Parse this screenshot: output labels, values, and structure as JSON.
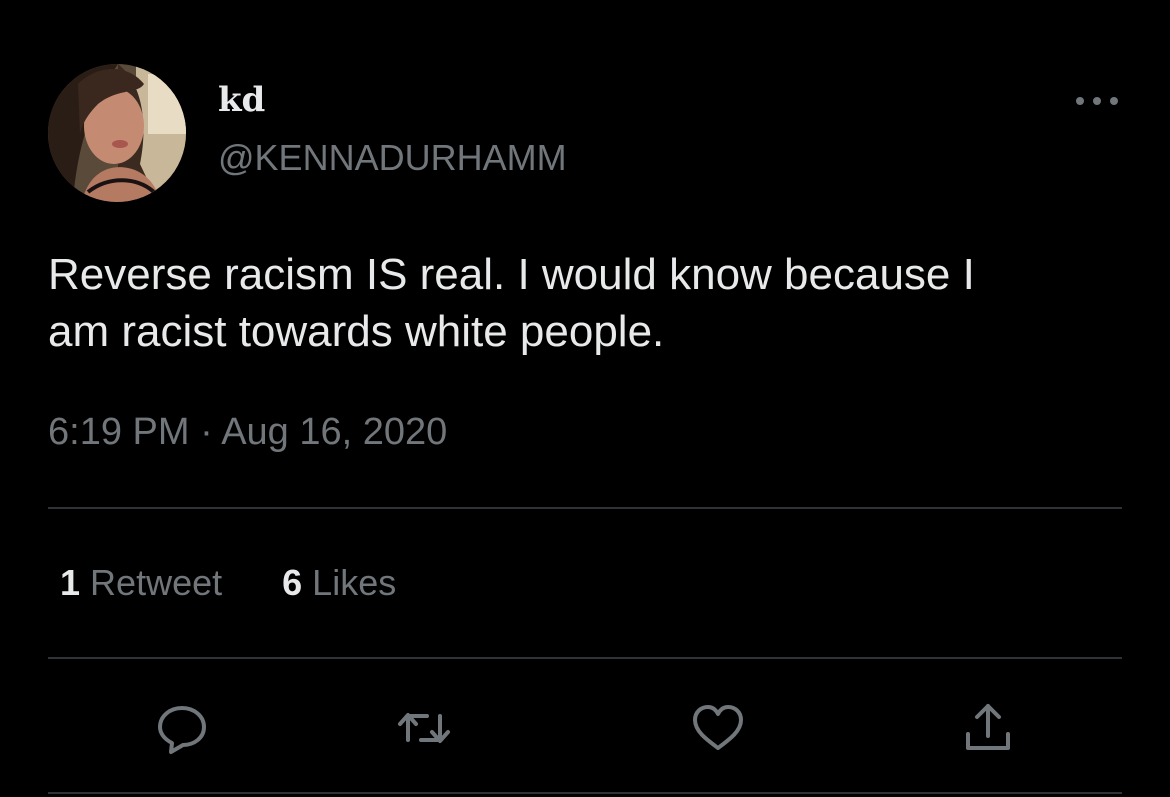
{
  "user": {
    "display_name": "kd",
    "handle": "@KENNADURHAMM"
  },
  "tweet": {
    "text_line1": "Reverse racism IS real. I would know because I",
    "text_line2": "am racist towards white people.",
    "timestamp": "6:19 PM · Aug 16, 2020"
  },
  "stats": {
    "retweets_count": "1",
    "retweets_label": "Retweet",
    "likes_count": "6",
    "likes_label": "Likes"
  },
  "actions": [
    {
      "icon": "reply-icon"
    },
    {
      "icon": "retweet-icon"
    },
    {
      "icon": "like-icon"
    },
    {
      "icon": "share-icon"
    }
  ],
  "colors": {
    "background": "#000000",
    "primary_text": "#e7e9ea",
    "secondary_text": "#71767b",
    "divider": "#2f3336"
  }
}
